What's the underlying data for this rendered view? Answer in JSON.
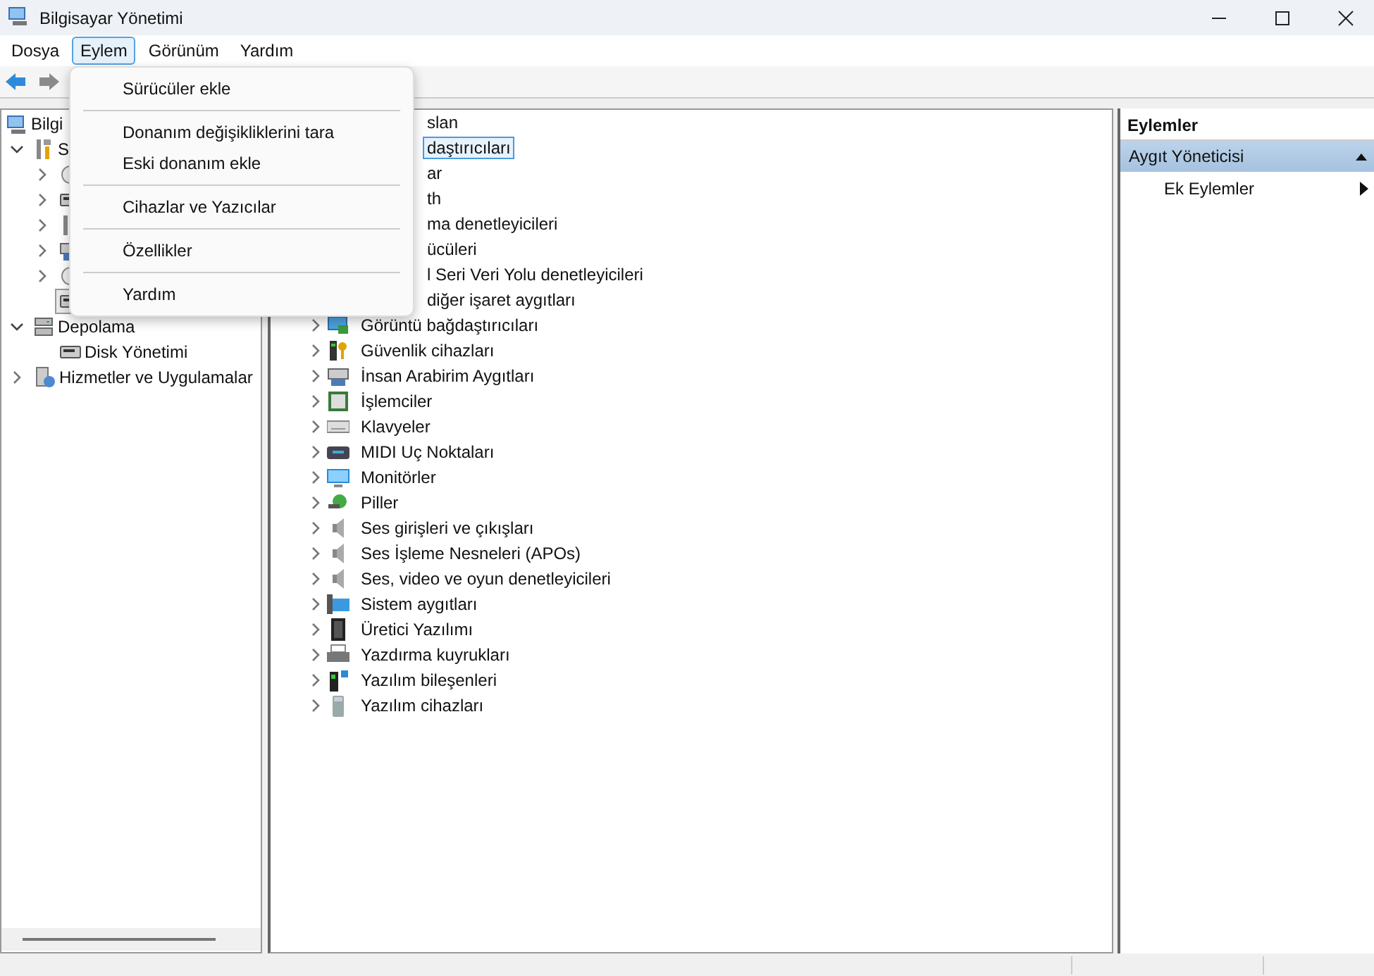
{
  "window": {
    "title": "Bilgisayar Yönetimi"
  },
  "menu_bar": [
    {
      "label": "Dosya",
      "selected": false
    },
    {
      "label": "Eylem",
      "selected": true
    },
    {
      "label": "Görünüm",
      "selected": false
    },
    {
      "label": "Yardım",
      "selected": false
    }
  ],
  "toolbar": [
    {
      "kind": "back",
      "disabled": false
    },
    {
      "kind": "forward",
      "disabled": true
    }
  ],
  "action_menu": {
    "groups": [
      {
        "items": [
          "Sürücüler ekle"
        ]
      },
      {
        "items": [
          "Donanım değişikliklerini tara",
          "Eski donanım ekle"
        ]
      },
      {
        "items": [
          "Cihazlar ve Yazıcılar"
        ]
      },
      {
        "items": [
          "Özellikler"
        ]
      },
      {
        "items": [
          "Yardım"
        ]
      }
    ]
  },
  "tree": [
    {
      "label": "Bilgi",
      "children": [
        {
          "label": "S",
          "expanded": true,
          "children": [
            {
              "expanded": false,
              "selected": false
            },
            {
              "expanded": false,
              "selected": false
            },
            {
              "expanded": false,
              "selected": false
            },
            {
              "expanded": false,
              "selected": false
            },
            {
              "expanded": false,
              "selected": false
            },
            {
              "selected": true
            }
          ]
        },
        {
          "label": "Depolama",
          "expanded": true,
          "children": [
            {
              "label": "Disk Yönetimi",
              "selected": false
            }
          ]
        },
        {
          "label": "Hizmetler ve Uygulamalar",
          "expanded": false,
          "selected": false
        }
      ]
    }
  ],
  "devices": [
    {
      "kind": "covered",
      "label": "slan",
      "selected": false
    },
    {
      "kind": "covered",
      "label": "daştırıcıları",
      "selected": true
    },
    {
      "kind": "covered",
      "label": "ar",
      "selected": false
    },
    {
      "kind": "covered",
      "label": "th",
      "selected": false
    },
    {
      "kind": "covered",
      "label": "ma denetleyicileri",
      "selected": false
    },
    {
      "kind": "covered",
      "label": "ücüleri",
      "selected": false
    },
    {
      "kind": "covered",
      "label": "l Seri Veri Yolu denetleyicileri",
      "selected": false
    },
    {
      "kind": "covered",
      "label": "diğer işaret aygıtları",
      "selected": false
    },
    {
      "kind": "full",
      "label": "Görüntü bağdaştırıcıları",
      "selected": false
    },
    {
      "kind": "full",
      "label": "Güvenlik cihazları",
      "selected": false
    },
    {
      "kind": "full",
      "label": "İnsan Arabirim Aygıtları",
      "selected": false
    },
    {
      "kind": "full",
      "label": "İşlemciler",
      "selected": false
    },
    {
      "kind": "full",
      "label": "Klavyeler",
      "selected": false
    },
    {
      "kind": "full",
      "label": "MIDI Uç Noktaları",
      "selected": false
    },
    {
      "kind": "full",
      "label": "Monitörler",
      "selected": false
    },
    {
      "kind": "full",
      "label": "Piller",
      "selected": false
    },
    {
      "kind": "full",
      "label": "Ses girişleri ve çıkışları",
      "selected": false
    },
    {
      "kind": "full",
      "label": "Ses İşleme Nesneleri (APOs)",
      "selected": false
    },
    {
      "kind": "full",
      "label": "Ses, video ve oyun denetleyicileri",
      "selected": false
    },
    {
      "kind": "full",
      "label": "Sistem aygıtları",
      "selected": false
    },
    {
      "kind": "full",
      "label": "Üretici Yazılımı",
      "selected": false
    },
    {
      "kind": "full",
      "label": "Yazdırma kuyrukları",
      "selected": false
    },
    {
      "kind": "full",
      "label": "Yazılım bileşenleri",
      "selected": false
    },
    {
      "kind": "full",
      "label": "Yazılım cihazları",
      "selected": false
    }
  ],
  "actions": {
    "title": "Eylemler",
    "sections": [
      {
        "label": "Aygıt Yöneticisi",
        "expanded": true,
        "items": [
          {
            "label": "Ek Eylemler"
          }
        ]
      }
    ]
  }
}
